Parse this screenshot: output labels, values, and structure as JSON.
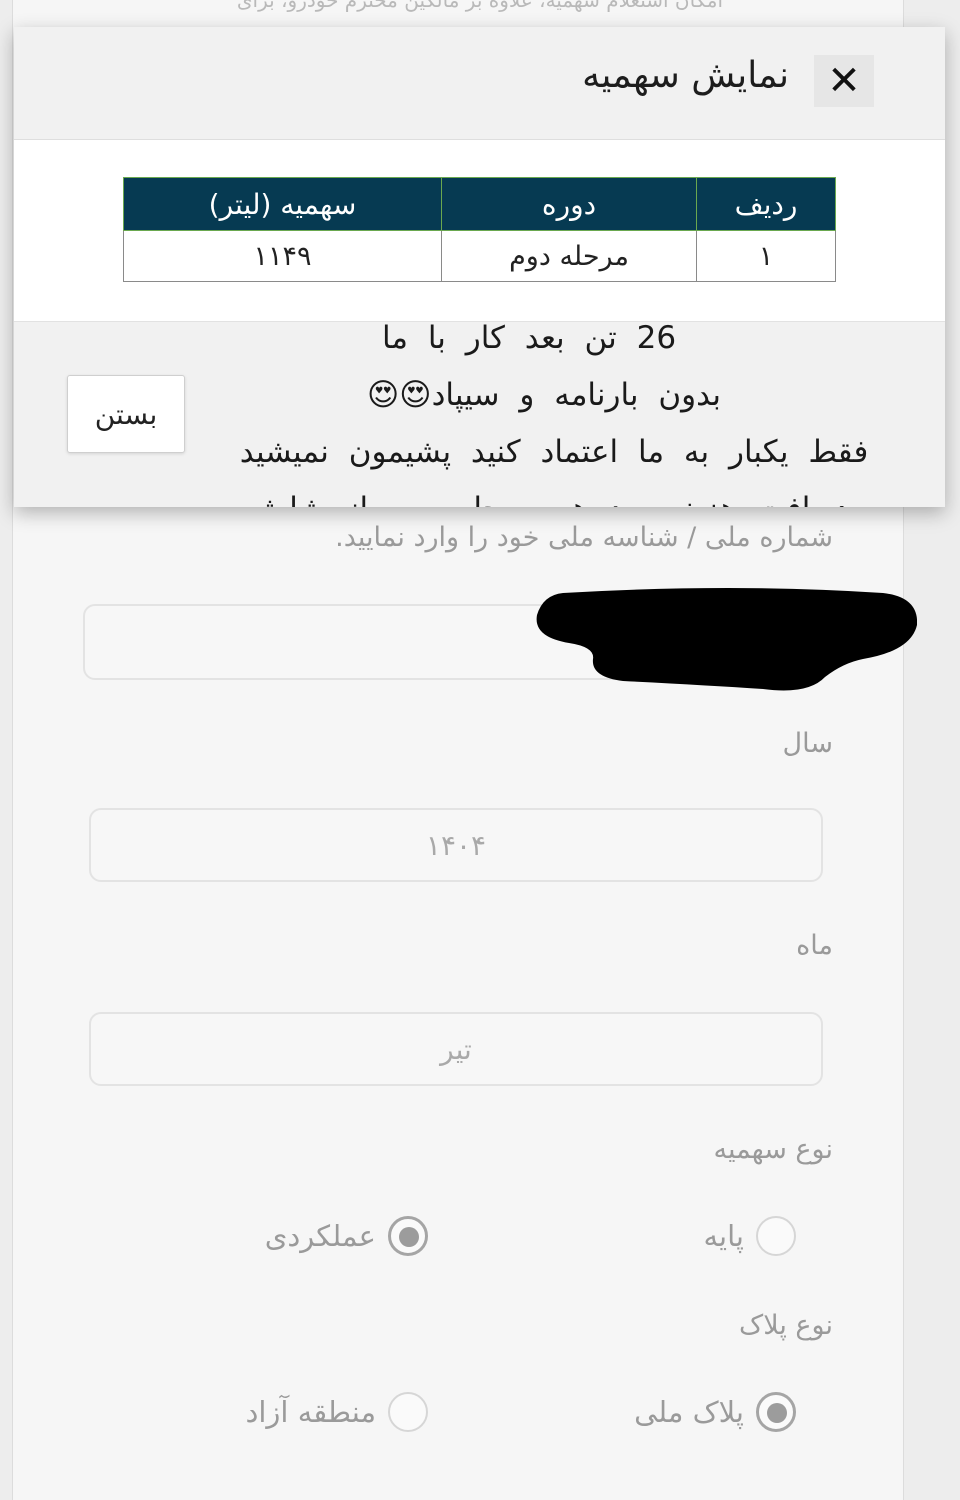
{
  "background_form": {
    "top_text": "امکان استعلام سهمیه، علاوه بر مالکین محترم خودرو، برای",
    "national_id_label": "شماره ملی / شناسه ملی خود را وارد نمایید.",
    "national_id_value": "",
    "year_label": "سال",
    "year_value": "۱۴۰۴",
    "month_label": "ماه",
    "month_value": "تیر",
    "quota_type_label": "نوع سهمیه",
    "quota_type_options": [
      {
        "label": "پایه",
        "selected": false
      },
      {
        "label": "عملکردی",
        "selected": true
      }
    ],
    "plate_type_label": "نوع پلاک",
    "plate_type_options": [
      {
        "label": "پلاک ملی",
        "selected": true
      },
      {
        "label": "منطقه آزاد",
        "selected": false
      }
    ]
  },
  "modal": {
    "title": "نمایش سهمیه",
    "close_icon": "✕",
    "table": {
      "headers": [
        "ردیف",
        "دوره",
        "سهمیه (لیتر)"
      ],
      "rows": [
        [
          "۱",
          "مرحله دوم",
          "۱۱۴۹"
        ]
      ]
    },
    "close_button_label": "بستن"
  },
  "overlay_text_lines": [
    "26 تن بعد کار با ما",
    "بدون بارنامه و سیپاد😍😍",
    "فقط یکبار به ما اعتماد کنید پشیمون نمیشید",
    "دریافت هزینه بعد هر مرحله پس از شارژ"
  ],
  "colors": {
    "table_header_bg": "#063a52",
    "table_header_border": "#6aa84f",
    "modal_header_bg": "#f1f1f1",
    "redaction": "#000000"
  }
}
